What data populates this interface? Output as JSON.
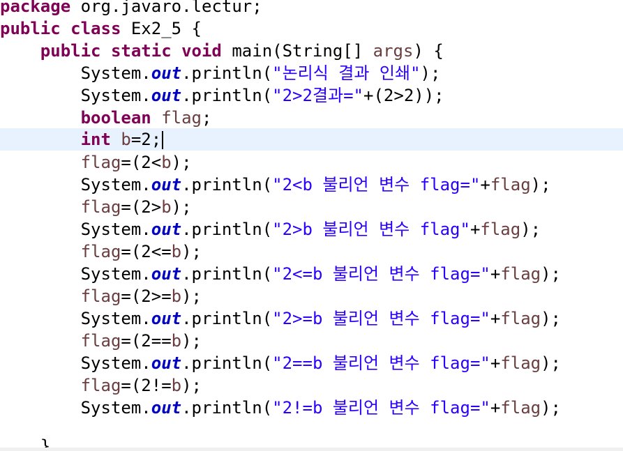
{
  "code": {
    "package_keyword": "package",
    "package_name": " org.javaro.lectur;",
    "class_decl_kw": "public class",
    "class_name": " Ex2_5 {",
    "main_kw": "public static void",
    "main_sig_a": " main(String[] ",
    "main_sig_param": "args",
    "main_sig_b": ") {",
    "sys": "System.",
    "out": "out",
    "println": ".println(",
    "l1_str": "\"논리식 결과 인쇄\"",
    "l1_end": ");",
    "l2_str": "\"2>2결과=\"",
    "l2_end": "+(2>2));",
    "boolean_kw": "boolean",
    "flag_decl": " flag",
    "semicolon": ";",
    "int_kw": "int",
    "b_var": " b",
    "b_assign": "=2;",
    "flag": "flag",
    "b": "b",
    "a1_op": "=(2<",
    "a2_op": "=(2>",
    "a3_op": "=(2<=",
    "a4_op": "=(2>=",
    "a5_op": "=(2==",
    "a6_op": "=(2!=",
    "assign_end": ");",
    "p1_str": "\"2<b 불리언 변수 flag=\"",
    "p2_str": "\"2>b 불리언 변수 flag\"",
    "p3_str": "\"2<=b 불리언 변수 flag=\"",
    "p4_str": "\"2>=b 불리언 변수 flag=\"",
    "p5_str": "\"2==b 불리언 변수 flag=\"",
    "p6_str": "\"2!=b 불리언 변수 flag=\"",
    "plus": "+",
    "print_end": ");",
    "closing_brace": "}"
  },
  "colors": {
    "keyword": "#7f0055",
    "static_field": "#0000c0",
    "local_variable": "#6a3e3e",
    "string": "#2a00ff",
    "current_line": "#e8f2fe"
  }
}
